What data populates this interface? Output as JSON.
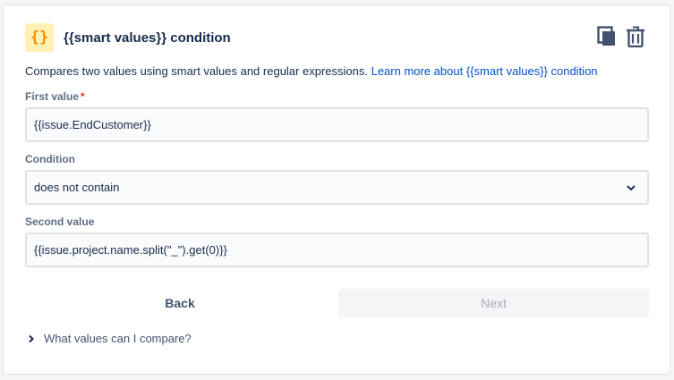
{
  "header": {
    "icon_glyph": "{}",
    "icon": "curly-braces-icon",
    "title": "{{smart values}} condition",
    "accent_color": "#ff8b00",
    "icon_bg_color": "#fff0b3"
  },
  "actions": {
    "duplicate_icon": "copy-icon",
    "delete_icon": "trash-icon"
  },
  "description": {
    "text": "Compares two values using smart values and regular expressions.",
    "link_text": "Learn more about {{smart values}} condition"
  },
  "first_value": {
    "label": "First value",
    "required_marker": "*",
    "value": "{{issue.EndCustomer}}"
  },
  "condition": {
    "label": "Condition",
    "selected": "does not contain"
  },
  "second_value": {
    "label": "Second value",
    "value": "{{issue.project.name.split(\"_\").get(0)}}"
  },
  "buttons": {
    "back": "Back",
    "next": "Next"
  },
  "help": {
    "expander_label": "What values can I compare?"
  }
}
